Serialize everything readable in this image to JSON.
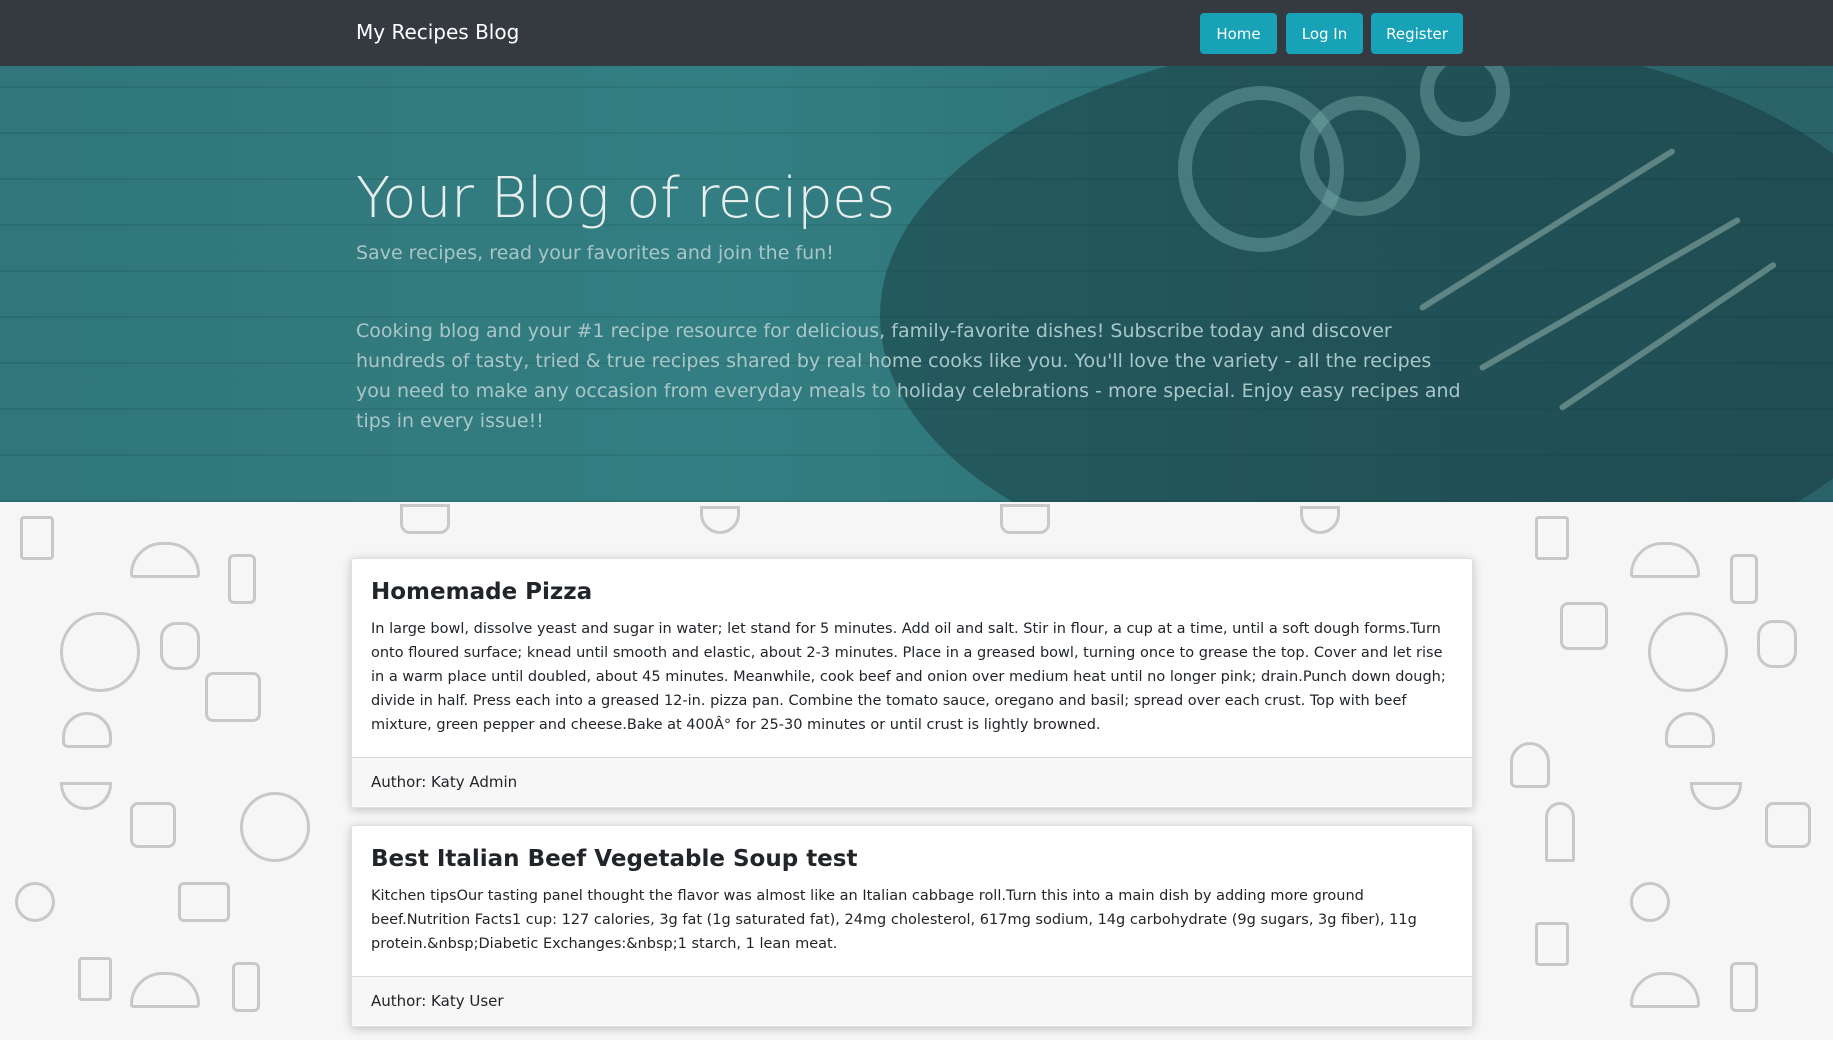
{
  "navbar": {
    "brand": "My Recipes Blog",
    "buttons": {
      "home": "Home",
      "login": "Log In",
      "register": "Register"
    },
    "accent_color": "#17a2b8",
    "background_color": "#343a40"
  },
  "hero": {
    "title": "Your Blog of recipes",
    "lead": "Save recipes, read your favorites and join the fun!",
    "description": "Cooking blog and your #1 recipe resource for delicious, family-favorite dishes! Subscribe today and discover hundreds of tasty, tried & true recipes shared by real home cooks like you. You'll love the variety - all the recipes you need to make any occasion from everyday meals to holiday celebrations - more special. Enjoy easy recipes and tips in every issue!!"
  },
  "posts": [
    {
      "title": "Homemade Pizza",
      "body": "In large bowl, dissolve yeast and sugar in water; let stand for 5 minutes. Add oil and salt. Stir in flour, a cup at a time, until a soft dough forms.Turn onto floured surface; knead until smooth and elastic, about 2-3 minutes. Place in a greased bowl, turning once to grease the top. Cover and let rise in a warm place until doubled, about 45 minutes. Meanwhile, cook beef and onion over medium heat until no longer pink; drain.Punch down dough; divide in half. Press each into a greased 12-in. pizza pan. Combine the tomato sauce, oregano and basil; spread over each crust. Top with beef mixture, green pepper and cheese.Bake at 400Â° for 25-30 minutes or until crust is lightly browned.",
      "author": "Author: Katy Admin"
    },
    {
      "title": "Best Italian Beef Vegetable Soup test",
      "body": "Kitchen tipsOur tasting panel thought the flavor was almost like an Italian cabbage roll.Turn this into a main dish by adding more ground beef.Nutrition Facts1 cup: 127 calories, 3g fat (1g saturated fat), 24mg cholesterol, 617mg sodium, 14g carbohydrate (9g sugars, 3g fiber), 11g protein.&nbsp;Diabetic Exchanges:&nbsp;1 starch, 1 lean meat.",
      "author": "Author: Katy User"
    }
  ]
}
